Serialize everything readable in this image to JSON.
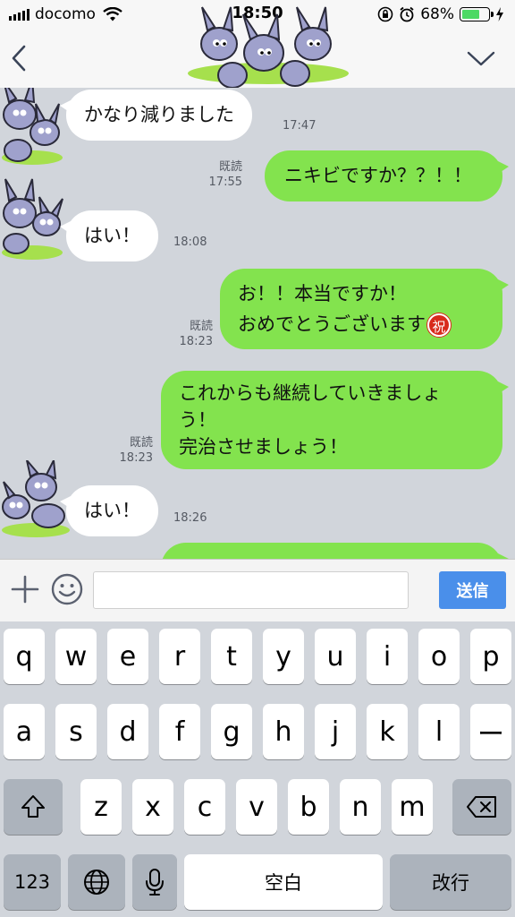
{
  "status_bar": {
    "carrier": "docomo",
    "time": "18:50",
    "battery_percent": "68%",
    "battery_level": 0.68,
    "signal_icon": "signal-bars-icon",
    "wifi_icon": "wifi-icon",
    "lock_icon": "orientation-lock-icon",
    "alarm_icon": "alarm-icon",
    "charging_icon": "charging-bolt-icon"
  },
  "header": {
    "back_icon": "chevron-left-icon",
    "menu_icon": "chevron-down-icon"
  },
  "messages": [
    {
      "direction": "in",
      "text": "かなり減りました",
      "time": "17:47",
      "read": ""
    },
    {
      "direction": "out",
      "text": "ニキビですか？？！！",
      "time": "17:55",
      "read": "既読"
    },
    {
      "direction": "in",
      "text": "はい！",
      "time": "18:08",
      "read": ""
    },
    {
      "direction": "out",
      "lines": [
        "お！！本当ですか！",
        "おめでとうございます"
      ],
      "emoji": "祝",
      "time": "18:23",
      "read": "既読"
    },
    {
      "direction": "out",
      "lines": [
        "これからも継続していきましょ",
        "う！",
        "完治させましょう！"
      ],
      "time": "18:23",
      "read": "既読"
    },
    {
      "direction": "in",
      "text": "はい！",
      "time": "18:26",
      "read": ""
    }
  ],
  "input_bar": {
    "plus_icon": "plus-icon",
    "emoji_icon": "smiley-icon",
    "message_value": "",
    "message_placeholder": "",
    "send_label": "送信"
  },
  "keyboard": {
    "row1": [
      "q",
      "w",
      "e",
      "r",
      "t",
      "y",
      "u",
      "i",
      "o",
      "p"
    ],
    "row2": [
      "a",
      "s",
      "d",
      "f",
      "g",
      "h",
      "j",
      "k",
      "l",
      "ー"
    ],
    "row3": [
      "z",
      "x",
      "c",
      "v",
      "b",
      "n",
      "m"
    ],
    "shift_icon": "shift-icon",
    "delete_icon": "backspace-icon",
    "numbers_label": "123",
    "globe_icon": "globe-icon",
    "mic_icon": "microphone-icon",
    "space_label": "空白",
    "return_label": "改行"
  },
  "colors": {
    "outgoing_bubble": "#83e34e",
    "incoming_bubble": "#ffffff",
    "chat_background": "#d1d5db",
    "send_button": "#4a8fea",
    "emoji_badge": "#d82a1c"
  },
  "stickers": {
    "icon": "rabbit-group-sticker-icon"
  }
}
